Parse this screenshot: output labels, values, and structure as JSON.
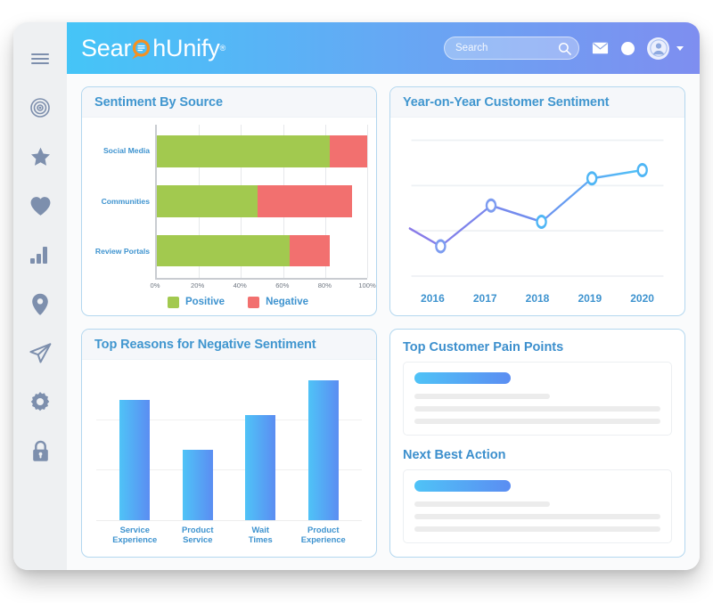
{
  "app": {
    "logo_pre": "Sear",
    "logo_post": "hUnify",
    "logo_reg": "®",
    "logo_full": "SearchUnify"
  },
  "topbar": {
    "search_placeholder": "Search",
    "search_value": "",
    "icons": {
      "search": "search-icon",
      "mail": "envelope-icon",
      "notification": "notification-dot-icon",
      "avatar": "user-avatar-icon",
      "caret": "chevron-down-icon"
    }
  },
  "sidebar": {
    "items": [
      {
        "icon": "hamburger-menu-icon",
        "name": "menu"
      },
      {
        "icon": "target-icon",
        "name": "target"
      },
      {
        "icon": "star-icon",
        "name": "star"
      },
      {
        "icon": "heart-icon",
        "name": "heart"
      },
      {
        "icon": "bar-chart-icon",
        "name": "analytics"
      },
      {
        "icon": "location-pin-icon",
        "name": "location"
      },
      {
        "icon": "paper-plane-icon",
        "name": "send"
      },
      {
        "icon": "gear-icon",
        "name": "settings"
      },
      {
        "icon": "lock-icon",
        "name": "security"
      }
    ]
  },
  "cards": {
    "sentiment_by_source": {
      "title": "Sentiment By Source"
    },
    "year_on_year": {
      "title": "Year-on-Year Customer Sentiment"
    },
    "top_reasons": {
      "title": "Top Reasons for Negative Sentiment"
    },
    "pain_points": {
      "title": "Top Customer Pain Points"
    },
    "next_best_action": {
      "title": "Next Best Action"
    }
  },
  "colors": {
    "positive": "#a2c94f",
    "negative": "#f2706f",
    "accent_blue": "#3e93cf",
    "gradient_start": "#4fc3f7",
    "gradient_end": "#5b8df2",
    "header_start": "#45c5f7",
    "header_end": "#7e8ef0",
    "logo_mark": "#f59120"
  },
  "chart_data": [
    {
      "type": "bar",
      "orientation": "horizontal",
      "stacked": true,
      "title": "Sentiment By Source",
      "xlabel": "",
      "ylabel": "",
      "categories": [
        "Social Media",
        "Communities",
        "Review Portals"
      ],
      "series": [
        {
          "name": "Positive",
          "color": "#a2c94f",
          "values": [
            82,
            48,
            63
          ]
        },
        {
          "name": "Negative",
          "color": "#f2706f",
          "values": [
            18,
            45,
            19
          ]
        }
      ],
      "xticks": [
        "0%",
        "20%",
        "40%",
        "60%",
        "80%",
        "100%"
      ],
      "xlim": [
        0,
        100
      ],
      "grid": true,
      "legend": "bottom"
    },
    {
      "type": "line",
      "title": "Year-on-Year Customer Sentiment",
      "xlabel": "",
      "ylabel": "",
      "x": [
        "2016",
        "2017",
        "2018",
        "2019",
        "2020"
      ],
      "values": [
        22,
        52,
        40,
        72,
        78
      ],
      "ylim": [
        0,
        100
      ],
      "grid": true,
      "gridlines": 4,
      "markers": "open-circle",
      "line_color_start": "#8a7ae8",
      "line_color_end": "#4fc3f7",
      "legend": "none"
    },
    {
      "type": "bar",
      "orientation": "vertical",
      "title": "Top Reasons for Negative Sentiment",
      "xlabel": "",
      "ylabel": "",
      "categories": [
        "Service Experience",
        "Product Service",
        "Wait Times",
        "Product Experience"
      ],
      "values": [
        80,
        47,
        70,
        93
      ],
      "ylim": [
        0,
        100
      ],
      "grid": true,
      "legend": "none"
    }
  ],
  "placeholders": {
    "pain_points": {
      "pill": "",
      "lines": 3
    },
    "next_best_action": {
      "pill": "",
      "lines": 3
    }
  }
}
